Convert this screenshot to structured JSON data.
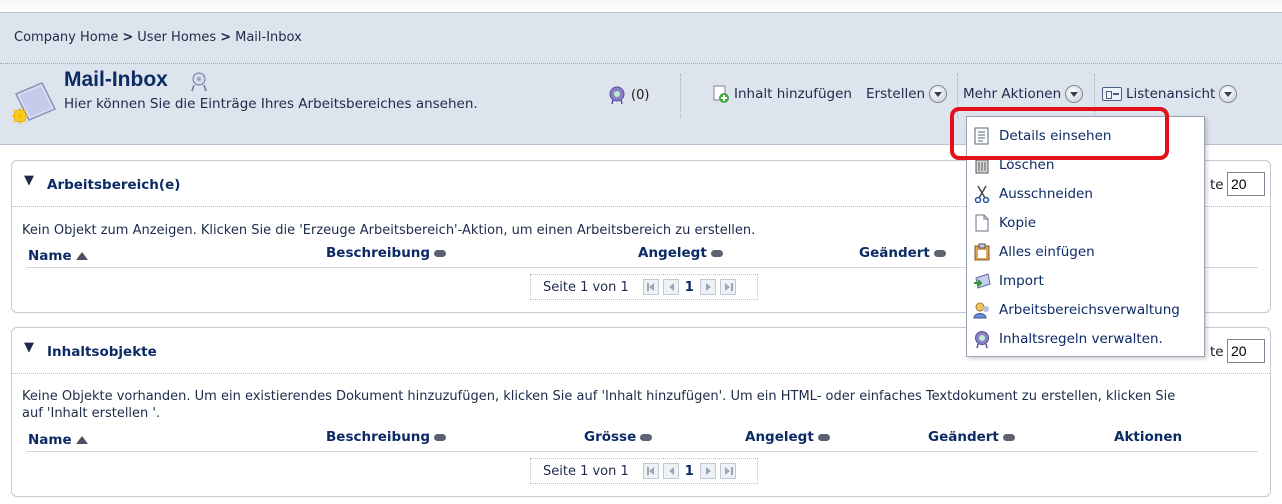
{
  "breadcrumb": {
    "items": [
      "Company Home",
      "User Homes",
      "Mail-Inbox"
    ],
    "separator": ">"
  },
  "header": {
    "title": "Mail-Inbox",
    "subtitle": "Hier können Sie die Einträge Ihres Arbeitsbereiches ansehen.",
    "rules_count": "(0)",
    "actions": {
      "add_content": "Inhalt hinzufügen",
      "create": "Erstellen",
      "more_actions": "Mehr Aktionen",
      "list_view": "Listenansicht"
    }
  },
  "more_actions_menu": {
    "items": [
      {
        "label": "Details einsehen",
        "icon": "details-icon"
      },
      {
        "label": "Löschen",
        "icon": "trash-icon"
      },
      {
        "label": "Ausschneiden",
        "icon": "scissors-icon"
      },
      {
        "label": "Kopie",
        "icon": "copy-icon"
      },
      {
        "label": "Alles einfügen",
        "icon": "clipboard-icon"
      },
      {
        "label": "Import",
        "icon": "import-icon"
      },
      {
        "label": "Arbeitsbereichsverwaltung",
        "icon": "users-icon"
      },
      {
        "label": "Inhaltsregeln verwalten.",
        "icon": "rules-icon"
      }
    ]
  },
  "spaces_panel": {
    "title": "Arbeitsbereich(e)",
    "page_size_label": "te",
    "page_size": "20",
    "message": "Kein Objekt zum Anzeigen. Klicken Sie die 'Erzeuge Arbeitsbereich'-Aktion, um einen Arbeitsbereich zu erstellen.",
    "columns": [
      "Name",
      "Beschreibung",
      "Angelegt",
      "Geändert"
    ],
    "pager": {
      "text": "Seite 1 von 1",
      "current": "1"
    }
  },
  "content_panel": {
    "title": "Inhaltsobjekte",
    "page_size_label": "te",
    "page_size": "20",
    "message_line1": "Keine Objekte vorhanden. Um ein existierendes Dokument hinzuzufügen, klicken Sie auf 'Inhalt hinzufügen'. Um ein HTML- oder einfaches Textdokument zu erstellen, klicken Sie",
    "message_line2": "auf 'Inhalt erstellen '.",
    "columns": [
      "Name",
      "Beschreibung",
      "Grösse",
      "Angelegt",
      "Geändert",
      "Aktionen"
    ],
    "pager": {
      "text": "Seite 1 von 1",
      "current": "1"
    }
  },
  "colors": {
    "header_bg": "#dde4ee",
    "title_blue": "#0c2a64",
    "highlight_red": "#e3101a"
  }
}
